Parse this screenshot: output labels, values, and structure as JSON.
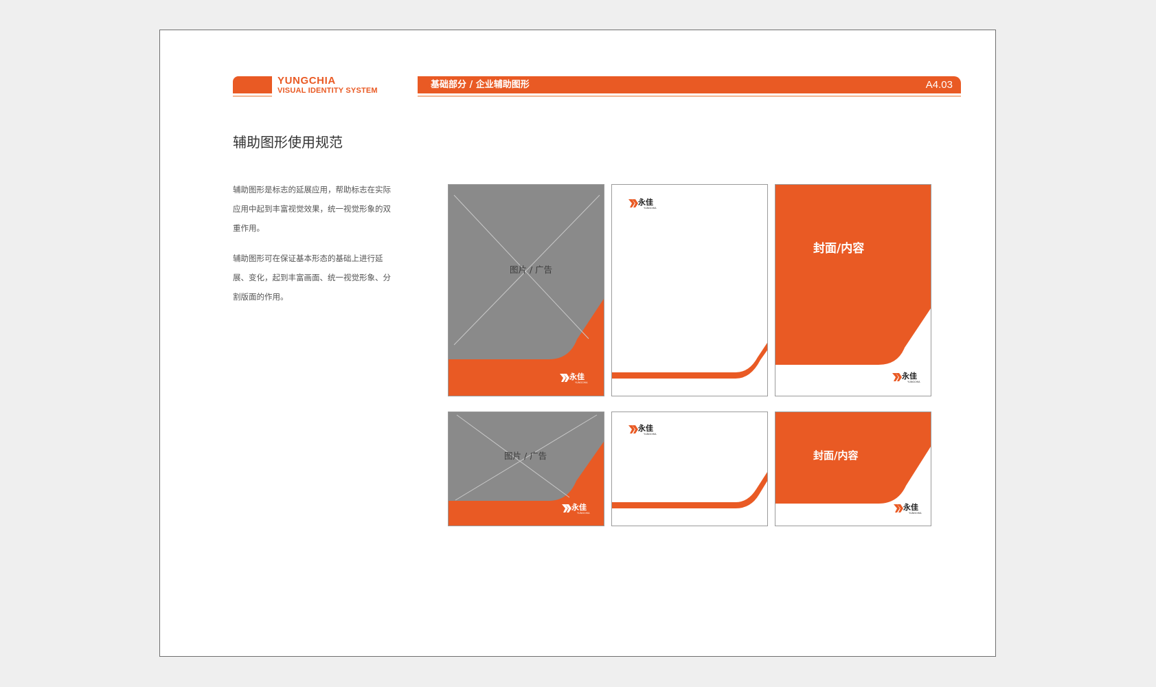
{
  "colors": {
    "accent": "#e95a24",
    "accent_light": "#f3b48f",
    "placeholder_gray": "#8a8a8a",
    "page_bg": "#efefef"
  },
  "header": {
    "brand_name": "YUNGCHIA",
    "brand_subtitle": "VISUAL IDENTITY SYSTEM",
    "breadcrumb": "基础部分 / 企业辅助图形",
    "page_code": "A4.03"
  },
  "section": {
    "title": "辅助图形使用规范",
    "paragraphs": [
      "辅助图形是标志的延展应用，帮助标志在实际应用中起到丰富视觉效果，统一视觉形象的双重作用。",
      "辅助图形可在保证基本形态的基础上进行延展、变化，起到丰富画面、统一视觉形象、分割版面的作用。"
    ]
  },
  "mockups": {
    "placeholder_label": "图片 / 广告",
    "cover_label": "封面/内容",
    "logo_cn": "永佳",
    "logo_en": "YUNGCHIA",
    "logo_icon": "yungchia-chevron-logo-icon"
  }
}
